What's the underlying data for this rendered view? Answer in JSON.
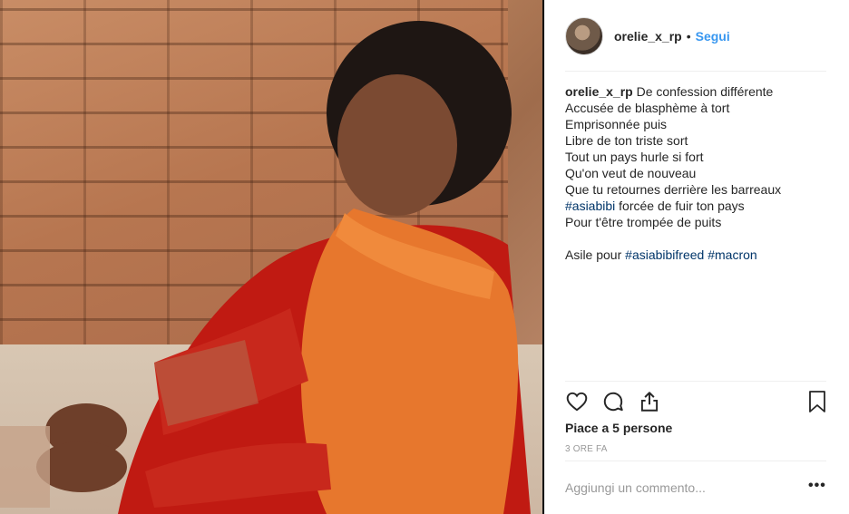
{
  "post": {
    "username": "orelie_x_rp",
    "follow_label": "Segui",
    "separator": "•",
    "image_alt": "Woman in orange shawl sitting in front of a brick wall"
  },
  "caption": {
    "user": "orelie_x_rp",
    "lines": [
      "De confession différente",
      "Accusée de blasphème à tort",
      "Emprisonnée puis",
      "Libre de ton triste sort",
      "Tout un pays hurle si fort",
      "Qu'on veut de nouveau",
      "Que tu retournes derrière les barreaux"
    ],
    "tag1": "#asiabibi",
    "line8_rest": " forcée de fuir ton pays",
    "line9": "Pour t'être trompée de puits",
    "line10_start": "Asile pour ",
    "tag2": "#asiabibifreed",
    "tag3": "#macron"
  },
  "actions": {
    "like_icon": "heart-icon",
    "comment_icon": "comment-icon",
    "share_icon": "share-icon",
    "save_icon": "bookmark-icon"
  },
  "likes_text": "Piace a 5 persone",
  "time_text": "3 ORE FA",
  "comment_box": {
    "placeholder": "Aggiungi un commento...",
    "more": "•••"
  },
  "colors": {
    "link": "#3897f0",
    "hashtag": "#003569",
    "muted": "#999999",
    "text": "#262626"
  }
}
